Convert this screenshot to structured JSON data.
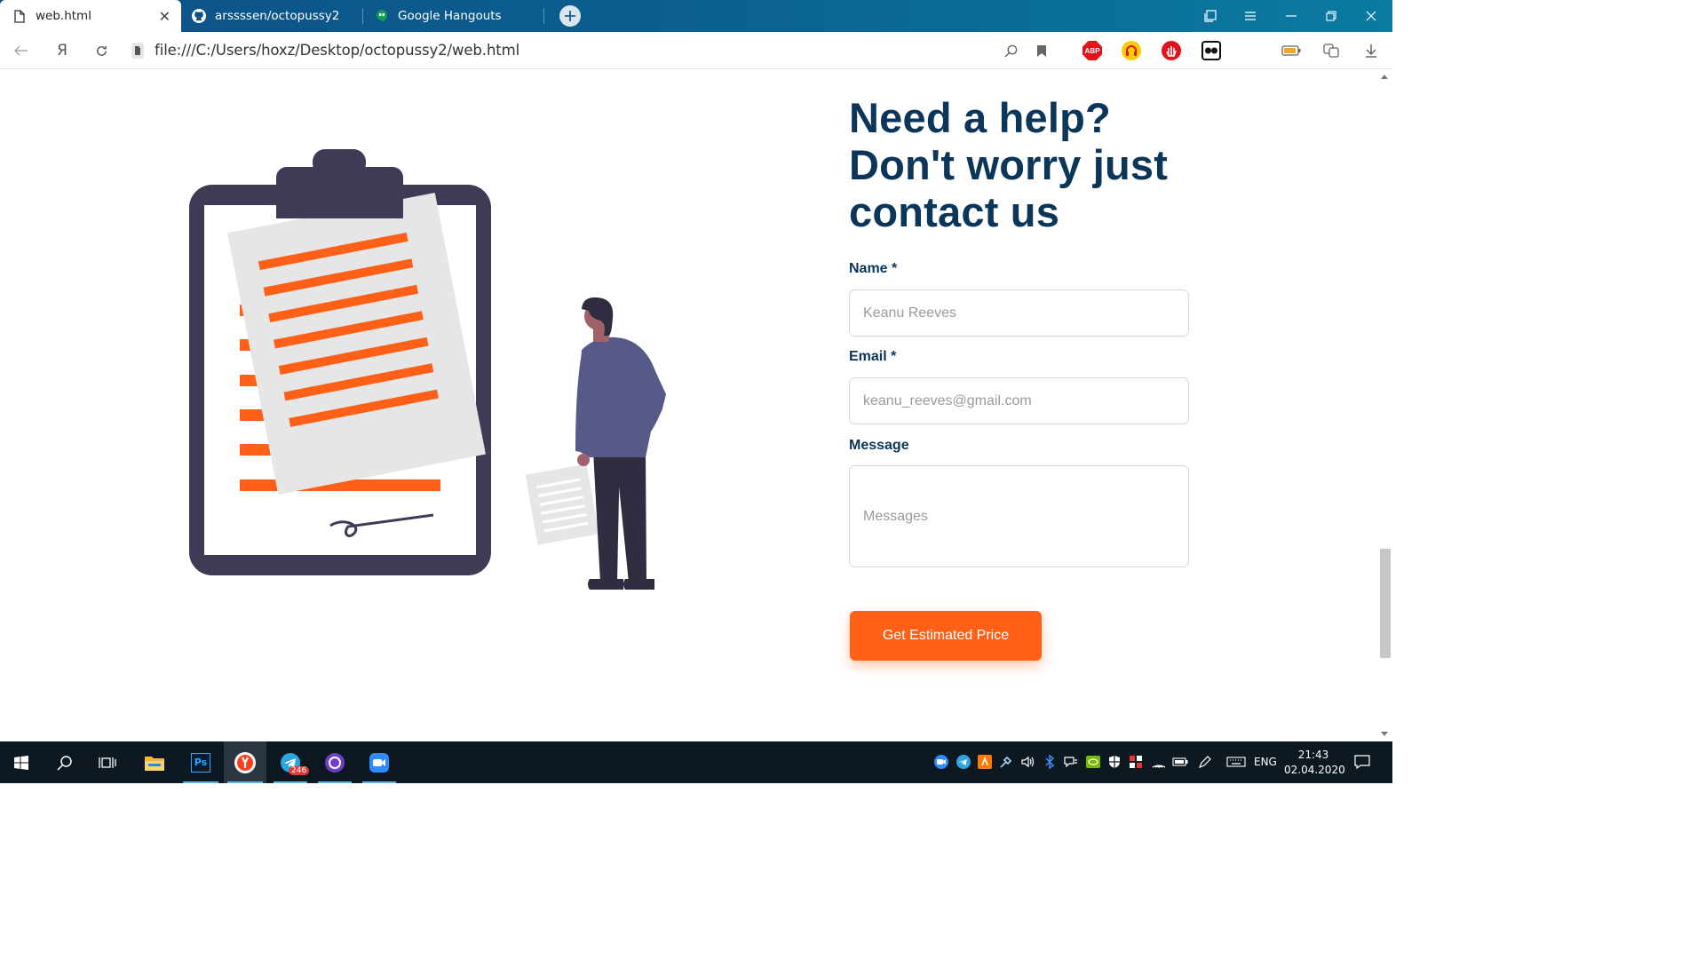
{
  "browser": {
    "tabs": [
      {
        "label": "web.html",
        "active": true,
        "icon": "file-icon"
      },
      {
        "label": "arssssen/octopussy2",
        "active": false,
        "icon": "github-icon"
      },
      {
        "label": "Google Hangouts",
        "active": false,
        "icon": "hangouts-icon"
      }
    ],
    "url": "file:///C:/Users/hoxz/Desktop/octopussy2/web.html",
    "extensions": [
      {
        "name": "adblock-plus-icon",
        "text": "ABP",
        "color": "#e3131b"
      },
      {
        "name": "headphones-ext-icon",
        "color": "#ffcc00"
      },
      {
        "name": "stop-hand-ext-icon",
        "color": "#e3131b"
      },
      {
        "name": "mask-ext-icon",
        "color": "#111111"
      }
    ]
  },
  "page": {
    "heading": "Need a help? Don't worry just contact us",
    "form": {
      "name_label": "Name *",
      "name_placeholder": "Keanu Reeves",
      "email_label": "Email *",
      "email_placeholder": "keanu_reeves@gmail.com",
      "message_label": "Message",
      "message_placeholder": "Messages",
      "submit_label": "Get Estimated Price"
    },
    "colors": {
      "accent": "#ff6017",
      "heading": "#0b3559",
      "clipboard": "#3f3a56",
      "person_shirt": "#575a89"
    }
  },
  "taskbar": {
    "apps": [
      "start-icon",
      "search-icon",
      "task-view-icon",
      "file-explorer-icon",
      "photoshop-icon",
      "yandex-browser-icon",
      "telegram-icon",
      "github-desktop-icon",
      "zoom-icon"
    ],
    "telegram_badge": "246",
    "photoshop_text": "Ps",
    "language": "ENG",
    "time": "21:43",
    "date": "02.04.2020"
  }
}
